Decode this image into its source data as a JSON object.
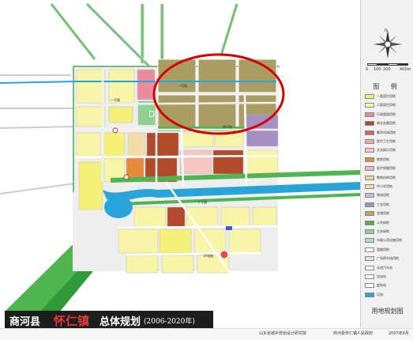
{
  "title": {
    "county": "商河县",
    "town": "怀仁镇",
    "suffix": "总体规划",
    "period": "(2006-2020年)"
  },
  "legend": {
    "heading": "图 例",
    "scale": [
      "0",
      "100",
      "200",
      "400m"
    ],
    "compass": "N",
    "items": [
      {
        "label": "一类居住用地",
        "color": "#f4f07a"
      },
      {
        "label": "二类居住用地",
        "color": "#f8f4a8"
      },
      {
        "label": "行政管理用地",
        "color": "#e98ca0"
      },
      {
        "label": "商业金融用地",
        "color": "#b04a2a"
      },
      {
        "label": "集贸市场用地",
        "color": "#cc6a4a"
      },
      {
        "label": "医疗卫生用地",
        "color": "#e7a99b"
      },
      {
        "label": "文化娱乐用地",
        "color": "#f4c8c0"
      },
      {
        "label": "教育用地",
        "color": "#e5893a"
      },
      {
        "label": "医疗保健用地",
        "color": "#e6b8c0"
      },
      {
        "label": "教育机构用地",
        "color": "#f0d090"
      },
      {
        "label": "中小学用地",
        "color": "#f4dca8"
      },
      {
        "label": "物流用地",
        "color": "#c7b8e0"
      },
      {
        "label": "工业用地",
        "color": "#a58fc3"
      },
      {
        "label": "仓储用地",
        "color": "#b3a76a"
      },
      {
        "label": "公共绿地",
        "color": "#4eb34e"
      },
      {
        "label": "生态绿地",
        "color": "#90d090"
      },
      {
        "label": "市政公用设施用地",
        "color": "#a8d8d8"
      },
      {
        "label": "道路用地",
        "color": "#ffffff"
      },
      {
        "label": "广场停车场用地",
        "color": "#e0e0e0"
      },
      {
        "label": "长途汽车站",
        "color": "#ffffff"
      },
      {
        "label": "加油站",
        "color": "#ffffff"
      },
      {
        "label": "变电站",
        "color": "#ffffff"
      },
      {
        "label": "河流",
        "color": "#29a4d8"
      }
    ],
    "footer_label": "用地规划图"
  },
  "map_labels": {
    "road_1": "一号路",
    "road_2": "商河路",
    "road_3": "一号路",
    "road_4": "十号路",
    "road_5": "环城路"
  },
  "footer": {
    "institute": "山东省城乡规划设计研究院",
    "government": "商河县怀仁镇人民政府",
    "date": "2007年6月"
  },
  "highlight": {
    "color": "#d80000"
  }
}
